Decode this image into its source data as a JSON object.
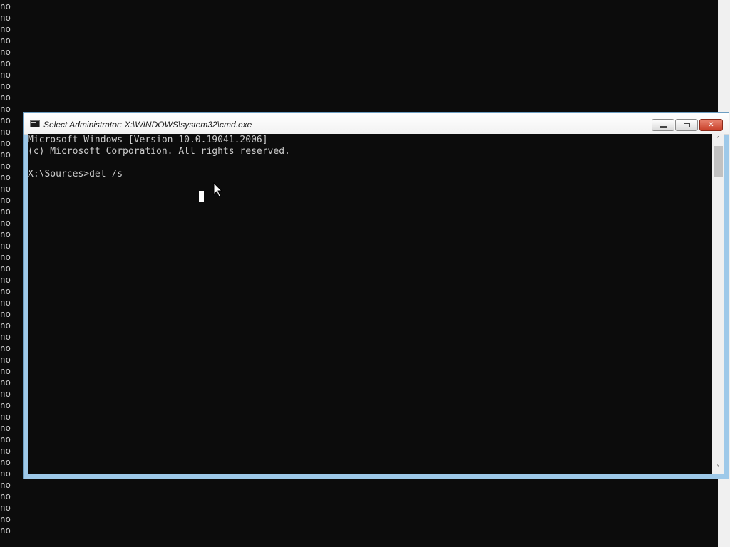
{
  "background_console": {
    "lines": [
      "no",
      "no",
      "no",
      "no",
      "no",
      "no",
      "no",
      "no",
      "no",
      "no",
      "no",
      "no",
      "no",
      "no",
      "no",
      "no",
      "no",
      "no",
      "no",
      "no",
      "no",
      "no",
      "no",
      "no",
      "no",
      "no",
      "no",
      "no",
      "no",
      "no",
      "no",
      "no",
      "no",
      "no",
      "no",
      "no",
      "no",
      "no",
      "no",
      "no",
      "no",
      "no",
      "no",
      "no",
      "no",
      "no",
      "no"
    ]
  },
  "window": {
    "title": "Select Administrator: X:\\WINDOWS\\system32\\cmd.exe",
    "icon": "cmd-icon",
    "controls": {
      "minimize_icon": "minimize-icon",
      "maximize_icon": "restore-icon",
      "close_label": "✕"
    }
  },
  "console": {
    "lines": [
      "Microsoft Windows [Version 10.0.19041.2006]",
      "(c) Microsoft Corporation. All rights reserved.",
      "",
      "X:\\Sources>del /s"
    ],
    "cursor": "text-cursor-block"
  },
  "scrollbar": {
    "up_arrow": "˄",
    "down_arrow": "˅"
  },
  "colors": {
    "console_bg": "#0c0c0c",
    "console_fg": "#cccccc",
    "window_frame": "#9ec9e9",
    "close_button": "#c8402a"
  }
}
